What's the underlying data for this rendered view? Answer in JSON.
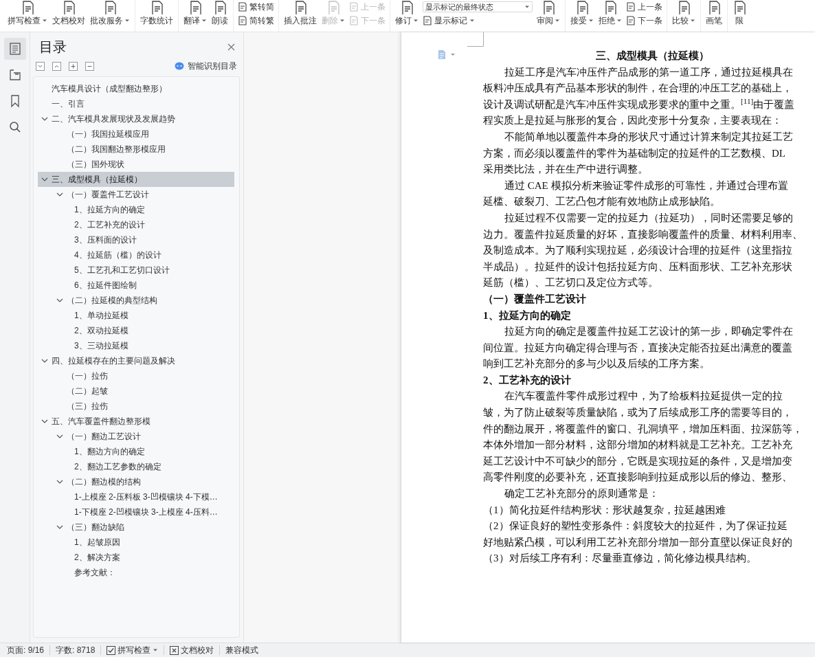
{
  "ribbon": {
    "groups": [
      {
        "tools": [
          {
            "kind": "large",
            "label": "拼写检查",
            "caret": true,
            "disabled": false
          },
          {
            "kind": "large",
            "label": "文档校对",
            "caret": false,
            "disabled": false
          },
          {
            "kind": "large",
            "label": "批改服务",
            "caret": true,
            "disabled": false
          }
        ]
      },
      {
        "tools": [
          {
            "kind": "large",
            "label": "字数统计",
            "caret": false,
            "disabled": false
          }
        ]
      },
      {
        "tools": [
          {
            "kind": "large",
            "label": "翻译",
            "caret": true,
            "disabled": false
          },
          {
            "kind": "large",
            "label": "朗读",
            "caret": false,
            "disabled": false
          }
        ]
      },
      {
        "tools": [
          {
            "kind": "stack",
            "rows": [
              {
                "kind": "small",
                "label": "繁转简",
                "disabled": false
              },
              {
                "kind": "small",
                "label": "简转繁",
                "disabled": false
              }
            ]
          }
        ]
      },
      {
        "tools": [
          {
            "kind": "large",
            "label": "插入批注",
            "caret": false,
            "disabled": false
          },
          {
            "kind": "large",
            "label": "删除",
            "caret": true,
            "disabled": true
          },
          {
            "kind": "stack",
            "rows": [
              {
                "kind": "small",
                "label": "上一条",
                "disabled": true
              },
              {
                "kind": "small",
                "label": "下一条",
                "disabled": true
              }
            ]
          }
        ]
      },
      {
        "tools": [
          {
            "kind": "large",
            "label": "修订",
            "caret": true,
            "disabled": false
          },
          {
            "kind": "stack",
            "rows": [
              {
                "kind": "select",
                "label": "显示标记的最终状态",
                "disabled": false
              },
              {
                "kind": "menu",
                "label": "显示标记",
                "disabled": false
              }
            ]
          },
          {
            "kind": "large",
            "label": "审阅",
            "caret": true,
            "disabled": false
          }
        ]
      },
      {
        "tools": [
          {
            "kind": "large",
            "label": "接受",
            "caret": true,
            "disabled": false
          },
          {
            "kind": "large",
            "label": "拒绝",
            "caret": true,
            "disabled": false
          },
          {
            "kind": "stack",
            "rows": [
              {
                "kind": "small",
                "label": "上一条",
                "disabled": false
              },
              {
                "kind": "small",
                "label": "下一条",
                "disabled": false
              }
            ]
          }
        ]
      },
      {
        "tools": [
          {
            "kind": "large",
            "label": "比较",
            "caret": true,
            "disabled": false
          }
        ]
      },
      {
        "tools": [
          {
            "kind": "large",
            "label": "画笔",
            "caret": false,
            "disabled": false
          }
        ]
      },
      {
        "tools": [
          {
            "kind": "large",
            "label": "限",
            "caret": false,
            "disabled": false
          }
        ]
      }
    ]
  },
  "rail": [
    {
      "selected": true
    },
    {
      "selected": false
    },
    {
      "selected": false
    },
    {
      "selected": false
    }
  ],
  "nav": {
    "title": "目录",
    "smart_button": "智能识别目录",
    "tree": [
      {
        "text": "汽车模具设计（成型翻边整形）",
        "selected": false
      },
      {
        "text": "一、引言",
        "selected": false
      },
      {
        "text": "二、汽车模具发展现状及发展趋势",
        "selected": false,
        "expanded": true,
        "children": [
          {
            "text": "（一）我国拉延模应用",
            "selected": false
          },
          {
            "text": "（二）我国翻边整形模应用",
            "selected": false
          },
          {
            "text": "（三）国外现状",
            "selected": false
          }
        ]
      },
      {
        "text": "三、成型模具（拉延模）",
        "selected": true,
        "expanded": true,
        "children": [
          {
            "text": "（一）覆盖件工艺设计",
            "selected": false,
            "expanded": true,
            "children": [
              {
                "text": "1、拉延方向的确定",
                "selected": false
              },
              {
                "text": "2、工艺补充的设计",
                "selected": false
              },
              {
                "text": "3、压料面的设计",
                "selected": false
              },
              {
                "text": "4、拉延筋（槛）的设计",
                "selected": false
              },
              {
                "text": "5、工艺孔和工艺切口设计",
                "selected": false
              },
              {
                "text": "6、拉延件图绘制",
                "selected": false
              }
            ]
          },
          {
            "text": "（二）拉延模的典型结构",
            "selected": false,
            "expanded": true,
            "children": [
              {
                "text": "1、单动拉延模",
                "selected": false
              },
              {
                "text": "2、双动拉延模",
                "selected": false
              },
              {
                "text": "3、三动拉延模",
                "selected": false
              }
            ]
          }
        ]
      },
      {
        "text": "四、拉延模存在的主要问题及解决",
        "selected": false,
        "expanded": true,
        "children": [
          {
            "text": "（一）拉伤",
            "selected": false
          },
          {
            "text": "（二）起皱",
            "selected": false
          },
          {
            "text": "（三）拉伤",
            "selected": false
          }
        ]
      },
      {
        "text": "五、汽车覆盖件翻边整形模",
        "selected": false,
        "expanded": true,
        "children": [
          {
            "text": "（一）翻边工艺设计",
            "selected": false,
            "expanded": true,
            "children": [
              {
                "text": "1、翻边方向的确定",
                "selected": false
              },
              {
                "text": "2、翻边工艺参数的确定",
                "selected": false
              }
            ]
          },
          {
            "text": "（二）翻边模的结构",
            "selected": false,
            "expanded": true,
            "children": [
              {
                "text": "1-上模座 2-压料板 3-凹模镶块 4-下模…",
                "selected": false
              },
              {
                "text": "1-下模座 2-凹模镶块 3-上模座 4-压料…",
                "selected": false
              }
            ]
          },
          {
            "text": "（三）翻边缺陷",
            "selected": false,
            "expanded": true,
            "children": [
              {
                "text": "1、起皱原因",
                "selected": false
              },
              {
                "text": "2、解决方案",
                "selected": false
              },
              {
                "text": "参考文献：",
                "selected": false
              }
            ]
          }
        ]
      }
    ]
  },
  "document": {
    "lines": [
      {
        "kind": "title",
        "text": "三、成型模具（拉延模）"
      },
      {
        "kind": "body",
        "indent": true,
        "text": "拉延工序是汽车冲压件产品成形的第一道工序，通过拉延模具在"
      },
      {
        "kind": "body",
        "indent": false,
        "text": "板料冲压成具有产品基本形状的制件，在合理的冲压工艺的基础上，"
      },
      {
        "kind": "body",
        "indent": false,
        "text": "设计及调试研配是汽车冲压件实现成形要求的重中之重。$^{[11]}$由于覆盖"
      },
      {
        "kind": "body",
        "indent": false,
        "text": "程实质上是拉延与胀形的复合，因此变形十分复杂，主要表现在："
      },
      {
        "kind": "body",
        "indent": true,
        "text": "不能简单地以覆盖件本身的形状尺寸通过计算来制定其拉延工艺"
      },
      {
        "kind": "body",
        "indent": false,
        "text": "方案，而必须以覆盖件的零件为基础制定的拉延件的工艺数模、DL"
      },
      {
        "kind": "body",
        "indent": false,
        "text": "采用类比法，并在生产中进行调整。"
      },
      {
        "kind": "body",
        "indent": true,
        "text": "通过 CAE 模拟分析来验证零件成形的可靠性，并通过合理布置"
      },
      {
        "kind": "body",
        "indent": false,
        "text": "延槛、破裂刀、工艺凸包才能有效地防止成形缺陷。"
      },
      {
        "kind": "body",
        "indent": true,
        "text": "拉延过程不仅需要一定的拉延力（拉延功），同时还需要足够的"
      },
      {
        "kind": "body",
        "indent": false,
        "text": "边力。覆盖件拉延质量的好坏，直接影响覆盖件的质量、材料利用率、"
      },
      {
        "kind": "body",
        "indent": false,
        "text": "及制造成本。为了顺利实现拉延，必须设计合理的拉延件（这里指拉"
      },
      {
        "kind": "body",
        "indent": false,
        "text": "半成品）。拉延件的设计包括拉延方向、压料面形状、工艺补充形状"
      },
      {
        "kind": "body",
        "indent": false,
        "text": "延筋（槛）、工艺切口及定位方式等。"
      },
      {
        "kind": "heading",
        "text": "（一）覆盖件工艺设计"
      },
      {
        "kind": "heading",
        "text": "1、拉延方向的确定"
      },
      {
        "kind": "body",
        "indent": true,
        "text": "拉延方向的确定是覆盖件拉延工艺设计的第一步，即确定零件在"
      },
      {
        "kind": "body",
        "indent": false,
        "text": "间位置。拉延方向确定得合理与否，直接决定能否拉延出满意的覆盖"
      },
      {
        "kind": "body",
        "indent": false,
        "text": "响到工艺补充部分的多与少以及后续的工序方案。"
      },
      {
        "kind": "heading",
        "text": "2、工艺补充的设计"
      },
      {
        "kind": "body",
        "indent": true,
        "text": "在汽车覆盖件零件成形过程中，为了给板料拉延提供一定的拉"
      },
      {
        "kind": "body",
        "indent": false,
        "text": "皱，为了防止破裂等质量缺陷，或为了后续成形工序的需要等目的，"
      },
      {
        "kind": "body",
        "indent": false,
        "text": "件的翻边展开，将覆盖件的窗口、孔洞填平，增加压料面、拉深筋等，"
      },
      {
        "kind": "body",
        "indent": false,
        "text": "本体外增加一部分材料，这部分增加的材料就是工艺补充。工艺补充"
      },
      {
        "kind": "body",
        "indent": false,
        "text": "延工艺设计中不可缺少的部分，它既是实现拉延的条件，又是增加变"
      },
      {
        "kind": "body",
        "indent": false,
        "text": "高零件刚度的必要补充，还直接影响到拉延成形以后的修边、整形、"
      },
      {
        "kind": "body",
        "indent": true,
        "text": "确定工艺补充部分的原则通常是："
      },
      {
        "kind": "body",
        "indent": false,
        "text": "（1）简化拉延件结构形状：形状越复杂，拉延越困难"
      },
      {
        "kind": "body",
        "indent": false,
        "text": "（2）保证良好的塑性变形条件：斜度较大的拉延件，为了保证拉延"
      },
      {
        "kind": "body",
        "indent": false,
        "text": "好地贴紧凸模，可以利用工艺补充部分增加一部分直壁以保证良好的"
      },
      {
        "kind": "body",
        "indent": false,
        "text": "（3）对后续工序有利：尽量垂直修边，简化修边模具结构。"
      }
    ]
  },
  "status_bar": [
    {
      "kind": "text",
      "label": "页面: 9/16"
    },
    {
      "kind": "text",
      "label": "字数: 8718"
    },
    {
      "kind": "check_menu",
      "label": "拼写检查"
    },
    {
      "kind": "proof",
      "label": "文档校对"
    },
    {
      "kind": "text",
      "label": "兼容模式"
    }
  ]
}
